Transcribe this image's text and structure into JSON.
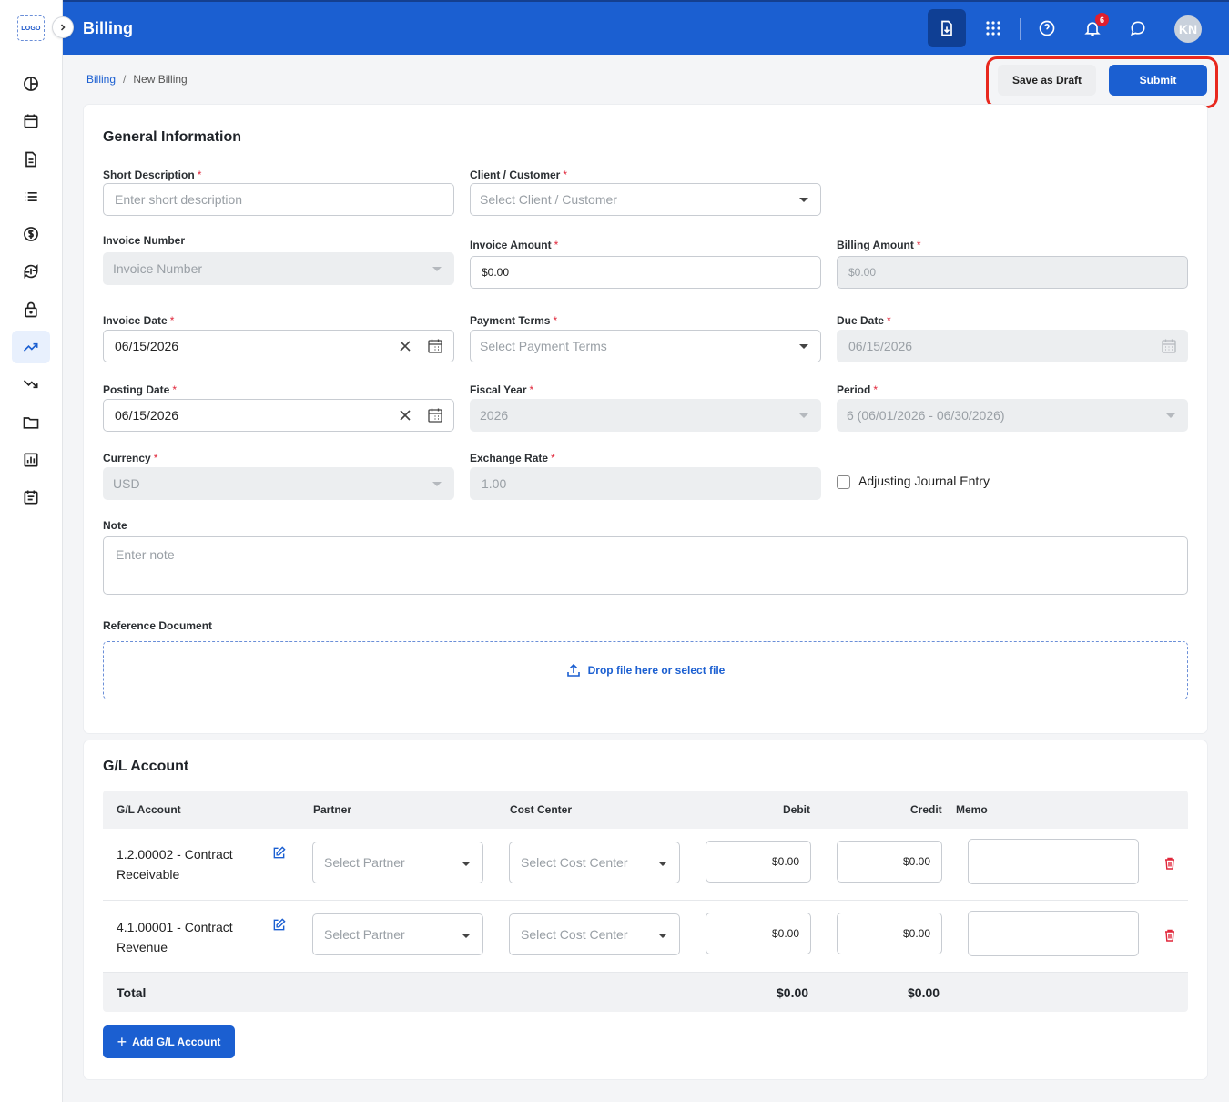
{
  "app": {
    "logo_text": "LOGO",
    "title": "Billing",
    "notification_count": "6",
    "avatar_initials": "KN"
  },
  "breadcrumb": {
    "root": "Billing",
    "separator": "/",
    "current": "New Billing"
  },
  "actions": {
    "draft_label": "Save as Draft",
    "submit_label": "Submit"
  },
  "sidebar": {
    "items": [
      {
        "icon": "dashboard-icon"
      },
      {
        "icon": "calendar-icon"
      },
      {
        "icon": "document-icon"
      },
      {
        "icon": "list-icon"
      },
      {
        "icon": "dollar-icon"
      },
      {
        "icon": "currency-exchange-icon"
      },
      {
        "icon": "lock-icon"
      },
      {
        "icon": "trending-up-icon",
        "active": true
      },
      {
        "icon": "trending-down-icon"
      },
      {
        "icon": "folder-icon"
      },
      {
        "icon": "bar-chart-icon"
      },
      {
        "icon": "event-note-icon"
      }
    ]
  },
  "general": {
    "title": "General Information",
    "short_description": {
      "label": "Short Description",
      "placeholder": "Enter short description"
    },
    "client": {
      "label": "Client / Customer",
      "placeholder": "Select Client / Customer"
    },
    "invoice_number": {
      "label": "Invoice Number",
      "placeholder": "Invoice Number"
    },
    "invoice_amount": {
      "label": "Invoice Amount",
      "value": "$0.00"
    },
    "billing_amount": {
      "label": "Billing Amount",
      "value": "$0.00"
    },
    "invoice_date": {
      "label": "Invoice Date",
      "value": "06/15/2026"
    },
    "payment_terms": {
      "label": "Payment Terms",
      "placeholder": "Select Payment Terms"
    },
    "due_date": {
      "label": "Due Date",
      "value": "06/15/2026"
    },
    "posting_date": {
      "label": "Posting Date",
      "value": "06/15/2026"
    },
    "fiscal_year": {
      "label": "Fiscal Year",
      "value": "2026"
    },
    "period": {
      "label": "Period",
      "value": "6 (06/01/2026 - 06/30/2026)"
    },
    "currency": {
      "label": "Currency",
      "value": "USD"
    },
    "exchange_rate": {
      "label": "Exchange Rate",
      "value": "1.00"
    },
    "adjusting_entry": {
      "label": "Adjusting Journal Entry",
      "checked": false
    },
    "note": {
      "label": "Note",
      "placeholder": "Enter note"
    },
    "reference": {
      "label": "Reference Document",
      "dropzone_text": "Drop file here or select file"
    },
    "required_mark": "*"
  },
  "gl": {
    "title": "G/L Account",
    "columns": {
      "account": "G/L Account",
      "partner": "Partner",
      "cost_center": "Cost Center",
      "debit": "Debit",
      "credit": "Credit",
      "memo": "Memo"
    },
    "rows": [
      {
        "account": "1.2.00002 - Contract Receivable",
        "partner_placeholder": "Select Partner",
        "cost_center_placeholder": "Select Cost Center",
        "debit": "$0.00",
        "credit": "$0.00",
        "memo": ""
      },
      {
        "account": "4.1.00001 - Contract Revenue",
        "partner_placeholder": "Select Partner",
        "cost_center_placeholder": "Select Cost Center",
        "debit": "$0.00",
        "credit": "$0.00",
        "memo": ""
      }
    ],
    "total": {
      "label": "Total",
      "debit": "$0.00",
      "credit": "$0.00"
    },
    "add_label": "Add G/L Account"
  },
  "colors": {
    "primary": "#1b5fd1",
    "topbar": "#1b5fd1",
    "highlight": "#e8281e",
    "required": "#e0263a",
    "danger": "#e0263a"
  }
}
